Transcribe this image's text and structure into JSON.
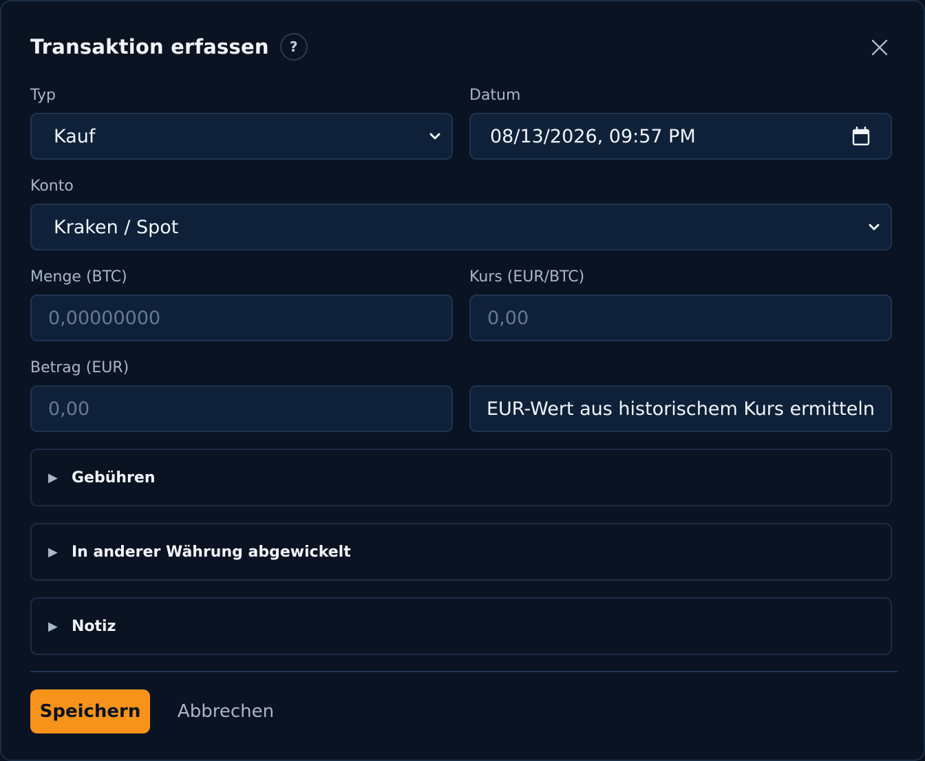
{
  "dialog": {
    "title": "Transaktion erfassen",
    "help_label": "?"
  },
  "form": {
    "type": {
      "label": "Typ",
      "value": "Kauf"
    },
    "date": {
      "label": "Datum",
      "value": "08/13/2026, 09:57 PM"
    },
    "account": {
      "label": "Konto",
      "value": "Kraken / Spot"
    },
    "quantity": {
      "label": "Menge (BTC)",
      "placeholder": "0,00000000"
    },
    "rate": {
      "label": "Kurs (EUR/BTC)",
      "placeholder": "0,00"
    },
    "amount": {
      "label": "Betrag (EUR)",
      "placeholder": "0,00"
    },
    "historical_button": "EUR-Wert aus historischem Kurs ermitteln"
  },
  "sections": [
    {
      "label": "Gebühren",
      "marker": "▶"
    },
    {
      "label": "In anderer Währung abgewickelt",
      "marker": "▶"
    },
    {
      "label": "Notiz",
      "marker": "▶"
    }
  ],
  "footer": {
    "save_label": "Speichern",
    "cancel_label": "Abbrechen"
  },
  "colors": {
    "accent": "#f7931a",
    "background": "#0a1322",
    "field_background": "#0f2139"
  }
}
